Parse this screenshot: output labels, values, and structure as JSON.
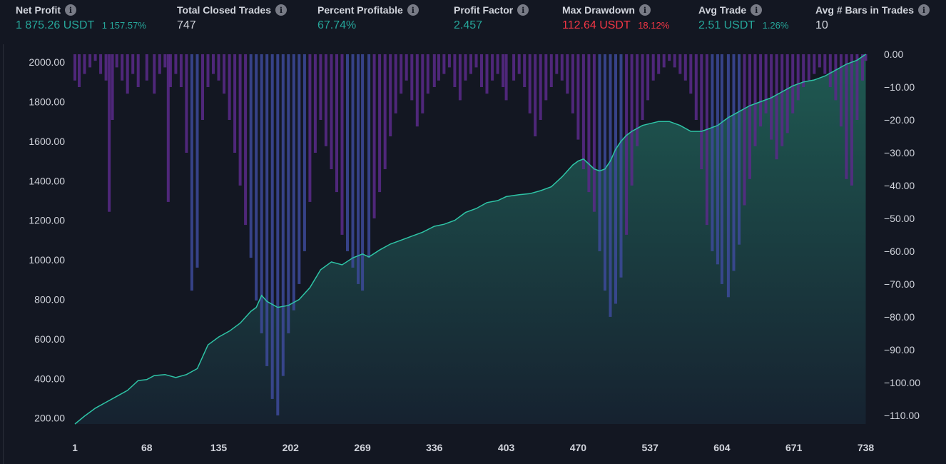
{
  "stats": [
    {
      "label": "Net Profit",
      "value": "1 875.26 USDT",
      "pct": "1 157.57%",
      "color": "green"
    },
    {
      "label": "Total Closed Trades",
      "value": "747",
      "pct": "",
      "color": "white"
    },
    {
      "label": "Percent Profitable",
      "value": "67.74%",
      "pct": "",
      "color": "green"
    },
    {
      "label": "Profit Factor",
      "value": "2.457",
      "pct": "",
      "color": "green"
    },
    {
      "label": "Max Drawdown",
      "value": "112.64 USDT",
      "pct": "18.12%",
      "color": "red"
    },
    {
      "label": "Avg Trade",
      "value": "2.51 USDT",
      "pct": "1.26%",
      "color": "green"
    },
    {
      "label": "Avg # Bars in Trades",
      "value": "10",
      "pct": "",
      "color": "white"
    }
  ],
  "icons": {
    "info": "info-icon"
  },
  "colors": {
    "equity_line": "#2ec4a6",
    "equity_fill_top": "#1f5a52",
    "equity_fill_bottom": "#162230",
    "drawdown": "#5a2a8a",
    "drawdown_deep": "#3d4a9a",
    "positive": "#26a69a",
    "negative": "#f23645",
    "background": "#131722"
  },
  "chart_data": {
    "type": "area",
    "series": [
      {
        "type": "area",
        "axis": "left",
        "x": [
          1,
          10,
          20,
          30,
          40,
          50,
          60,
          68,
          75,
          85,
          95,
          105,
          115,
          125,
          135,
          145,
          155,
          165,
          170,
          175,
          180,
          190,
          200,
          210,
          220,
          230,
          240,
          250,
          260,
          269,
          275,
          285,
          295,
          305,
          315,
          325,
          336,
          345,
          355,
          365,
          375,
          385,
          395,
          403,
          415,
          425,
          435,
          445,
          455,
          465,
          470,
          475,
          485,
          490,
          495,
          500,
          505,
          510,
          515,
          520,
          530,
          545,
          555,
          565,
          575,
          585,
          590,
          600,
          610,
          620,
          630,
          640,
          650,
          660,
          670,
          680,
          690,
          700,
          710,
          720,
          730,
          738
        ],
        "values": [
          170,
          210,
          250,
          280,
          310,
          340,
          390,
          395,
          415,
          420,
          405,
          420,
          450,
          570,
          610,
          640,
          680,
          740,
          760,
          820,
          790,
          760,
          770,
          800,
          860,
          950,
          990,
          975,
          1010,
          1030,
          1015,
          1050,
          1080,
          1100,
          1120,
          1140,
          1170,
          1180,
          1200,
          1240,
          1260,
          1290,
          1300,
          1320,
          1330,
          1335,
          1350,
          1370,
          1420,
          1480,
          1500,
          1510,
          1460,
          1450,
          1460,
          1500,
          1560,
          1600,
          1630,
          1650,
          1680,
          1700,
          1700,
          1680,
          1650,
          1650,
          1660,
          1680,
          1720,
          1750,
          1780,
          1800,
          1820,
          1850,
          1880,
          1900,
          1910,
          1930,
          1960,
          1990,
          2010,
          2040
        ]
      },
      {
        "type": "bar",
        "axis": "right",
        "x": [
          1,
          5,
          10,
          15,
          20,
          25,
          30,
          33,
          36,
          40,
          45,
          50,
          55,
          60,
          68,
          75,
          80,
          85,
          88,
          90,
          95,
          100,
          105,
          110,
          115,
          120,
          125,
          130,
          135,
          140,
          145,
          150,
          155,
          160,
          165,
          170,
          175,
          180,
          185,
          190,
          195,
          200,
          205,
          210,
          215,
          220,
          225,
          230,
          235,
          240,
          245,
          250,
          255,
          260,
          265,
          269,
          275,
          280,
          285,
          290,
          295,
          300,
          305,
          310,
          315,
          320,
          325,
          330,
          336,
          340,
          345,
          350,
          355,
          360,
          365,
          370,
          375,
          380,
          385,
          390,
          395,
          400,
          403,
          410,
          415,
          420,
          425,
          430,
          435,
          440,
          445,
          450,
          455,
          460,
          465,
          470,
          475,
          480,
          485,
          490,
          495,
          500,
          505,
          510,
          515,
          520,
          525,
          530,
          535,
          540,
          545,
          550,
          555,
          560,
          565,
          570,
          575,
          580,
          585,
          590,
          595,
          600,
          604,
          610,
          615,
          620,
          625,
          630,
          635,
          640,
          645,
          650,
          655,
          660,
          665,
          670,
          675,
          680,
          685,
          690,
          695,
          700,
          705,
          710,
          715,
          720,
          725,
          730,
          735,
          738
        ],
        "values": [
          -8,
          -10,
          -6,
          -4,
          -2,
          -6,
          -8,
          -48,
          -20,
          -4,
          -8,
          -12,
          -6,
          -10,
          -8,
          -12,
          -6,
          -4,
          -45,
          -10,
          -6,
          -10,
          -30,
          -72,
          -65,
          -20,
          -10,
          -6,
          -8,
          -12,
          -20,
          -30,
          -40,
          -52,
          -62,
          -75,
          -85,
          -95,
          -105,
          -110,
          -98,
          -85,
          -78,
          -70,
          -60,
          -45,
          -30,
          -20,
          -28,
          -35,
          -42,
          -55,
          -60,
          -65,
          -70,
          -72,
          -62,
          -50,
          -42,
          -35,
          -25,
          -18,
          -12,
          -8,
          -14,
          -22,
          -18,
          -12,
          -10,
          -8,
          -6,
          -4,
          -10,
          -14,
          -8,
          -6,
          -4,
          -10,
          -12,
          -8,
          -6,
          -10,
          -14,
          -8,
          -6,
          -10,
          -18,
          -25,
          -20,
          -14,
          -10,
          -6,
          -8,
          -12,
          -18,
          -26,
          -35,
          -42,
          -48,
          -60,
          -72,
          -80,
          -76,
          -68,
          -55,
          -40,
          -28,
          -20,
          -14,
          -8,
          -6,
          -4,
          -2,
          -4,
          -6,
          -8,
          -12,
          -20,
          -35,
          -52,
          -60,
          -64,
          -70,
          -74,
          -66,
          -58,
          -46,
          -38,
          -28,
          -22,
          -18,
          -26,
          -32,
          -28,
          -24,
          -18,
          -14,
          -10,
          -8,
          -6,
          -4,
          -6,
          -10,
          -14,
          -22,
          -38,
          -40,
          -20,
          -8,
          -2
        ]
      }
    ],
    "y_left": {
      "ticks": [
        "2000.00",
        "1800.00",
        "1600.00",
        "1400.00",
        "1200.00",
        "1000.00",
        "800.00",
        "600.00",
        "400.00",
        "200.00"
      ],
      "range": [
        170,
        2040
      ]
    },
    "y_right": {
      "ticks": [
        "0.00",
        "−10.00",
        "−20.00",
        "−30.00",
        "−40.00",
        "−50.00",
        "−60.00",
        "−70.00",
        "−80.00",
        "−90.00",
        "−100.00",
        "−110.00"
      ],
      "range": [
        -112.64,
        0
      ]
    },
    "x_ticks": [
      "1",
      "68",
      "135",
      "202",
      "269",
      "336",
      "403",
      "470",
      "537",
      "604",
      "671",
      "738"
    ],
    "xlim": [
      1,
      747
    ],
    "grid": false
  }
}
